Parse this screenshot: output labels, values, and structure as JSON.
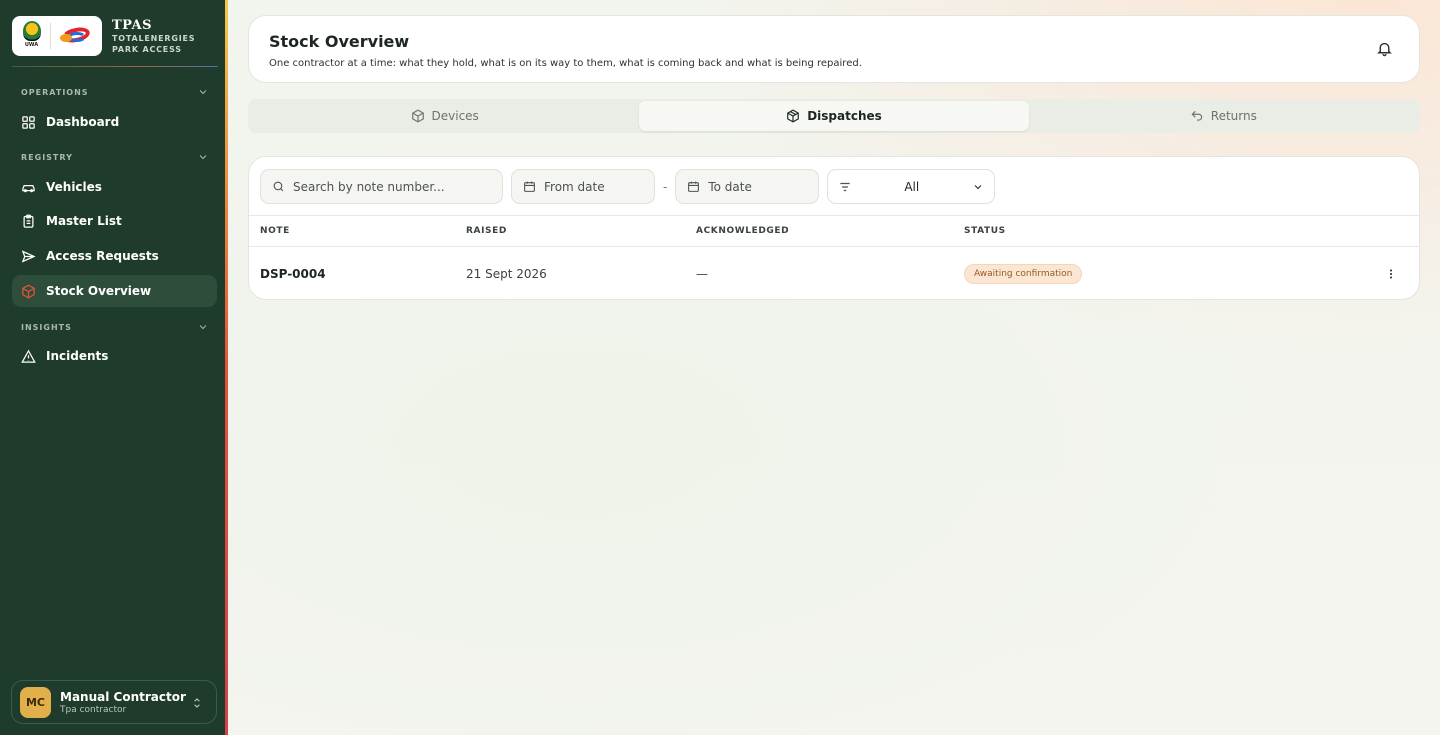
{
  "brand": {
    "title": "TPAS",
    "subtitle_line1": "TOTALENERGIES",
    "subtitle_line2": "PARK ACCESS",
    "uwa_logo_text": "UWA"
  },
  "sidebar": {
    "sections": [
      {
        "label": "OPERATIONS",
        "items": [
          {
            "label": "Dashboard",
            "icon": "grid-icon"
          }
        ]
      },
      {
        "label": "REGISTRY",
        "items": [
          {
            "label": "Vehicles",
            "icon": "car-icon"
          },
          {
            "label": "Master List",
            "icon": "clipboard-icon"
          },
          {
            "label": "Access Requests",
            "icon": "send-icon"
          },
          {
            "label": "Stock Overview",
            "icon": "package-icon",
            "active": true
          }
        ]
      },
      {
        "label": "INSIGHTS",
        "items": [
          {
            "label": "Incidents",
            "icon": "warning-icon"
          }
        ]
      }
    ]
  },
  "user": {
    "initials": "MC",
    "name": "Manual Contractor",
    "role": "Tpa contractor"
  },
  "header": {
    "title": "Stock Overview",
    "description": "One contractor at a time: what they hold, what is on its way to them, what is coming back and what is being repaired."
  },
  "tabs": [
    {
      "label": "Devices",
      "icon": "box-icon"
    },
    {
      "label": "Dispatches",
      "icon": "package-icon",
      "active": true
    },
    {
      "label": "Returns",
      "icon": "undo-icon"
    }
  ],
  "filters": {
    "search_placeholder": "Search by note number...",
    "from_date": "From date",
    "to_date": "To date",
    "separator": "-",
    "status_value": "All"
  },
  "table": {
    "columns": [
      "NOTE",
      "RAISED",
      "ACKNOWLEDGED",
      "STATUS"
    ],
    "rows": [
      {
        "note": "DSP-0004",
        "raised": "21 Sept 2026",
        "acknowledged": "—",
        "status": "Awaiting confirmation"
      }
    ]
  },
  "colors": {
    "sidebar_bg": "#1f3b2b",
    "accent_active": "#e1543a",
    "status_badge_bg": "#fbe6d3"
  }
}
